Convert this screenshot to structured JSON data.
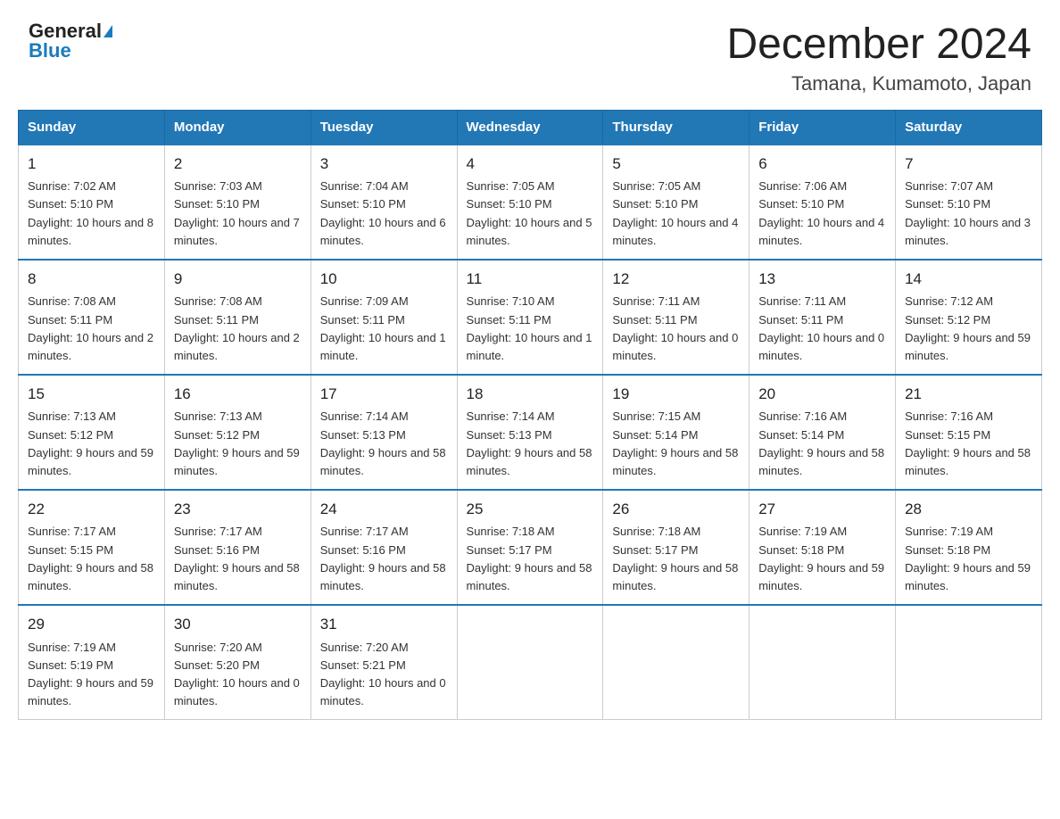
{
  "header": {
    "logo_general": "General",
    "logo_blue": "Blue",
    "title": "December 2024",
    "subtitle": "Tamana, Kumamoto, Japan"
  },
  "calendar": {
    "days_of_week": [
      "Sunday",
      "Monday",
      "Tuesday",
      "Wednesday",
      "Thursday",
      "Friday",
      "Saturday"
    ],
    "weeks": [
      [
        {
          "day": "1",
          "sunrise": "7:02 AM",
          "sunset": "5:10 PM",
          "daylight": "10 hours and 8 minutes."
        },
        {
          "day": "2",
          "sunrise": "7:03 AM",
          "sunset": "5:10 PM",
          "daylight": "10 hours and 7 minutes."
        },
        {
          "day": "3",
          "sunrise": "7:04 AM",
          "sunset": "5:10 PM",
          "daylight": "10 hours and 6 minutes."
        },
        {
          "day": "4",
          "sunrise": "7:05 AM",
          "sunset": "5:10 PM",
          "daylight": "10 hours and 5 minutes."
        },
        {
          "day": "5",
          "sunrise": "7:05 AM",
          "sunset": "5:10 PM",
          "daylight": "10 hours and 4 minutes."
        },
        {
          "day": "6",
          "sunrise": "7:06 AM",
          "sunset": "5:10 PM",
          "daylight": "10 hours and 4 minutes."
        },
        {
          "day": "7",
          "sunrise": "7:07 AM",
          "sunset": "5:10 PM",
          "daylight": "10 hours and 3 minutes."
        }
      ],
      [
        {
          "day": "8",
          "sunrise": "7:08 AM",
          "sunset": "5:11 PM",
          "daylight": "10 hours and 2 minutes."
        },
        {
          "day": "9",
          "sunrise": "7:08 AM",
          "sunset": "5:11 PM",
          "daylight": "10 hours and 2 minutes."
        },
        {
          "day": "10",
          "sunrise": "7:09 AM",
          "sunset": "5:11 PM",
          "daylight": "10 hours and 1 minute."
        },
        {
          "day": "11",
          "sunrise": "7:10 AM",
          "sunset": "5:11 PM",
          "daylight": "10 hours and 1 minute."
        },
        {
          "day": "12",
          "sunrise": "7:11 AM",
          "sunset": "5:11 PM",
          "daylight": "10 hours and 0 minutes."
        },
        {
          "day": "13",
          "sunrise": "7:11 AM",
          "sunset": "5:11 PM",
          "daylight": "10 hours and 0 minutes."
        },
        {
          "day": "14",
          "sunrise": "7:12 AM",
          "sunset": "5:12 PM",
          "daylight": "9 hours and 59 minutes."
        }
      ],
      [
        {
          "day": "15",
          "sunrise": "7:13 AM",
          "sunset": "5:12 PM",
          "daylight": "9 hours and 59 minutes."
        },
        {
          "day": "16",
          "sunrise": "7:13 AM",
          "sunset": "5:12 PM",
          "daylight": "9 hours and 59 minutes."
        },
        {
          "day": "17",
          "sunrise": "7:14 AM",
          "sunset": "5:13 PM",
          "daylight": "9 hours and 58 minutes."
        },
        {
          "day": "18",
          "sunrise": "7:14 AM",
          "sunset": "5:13 PM",
          "daylight": "9 hours and 58 minutes."
        },
        {
          "day": "19",
          "sunrise": "7:15 AM",
          "sunset": "5:14 PM",
          "daylight": "9 hours and 58 minutes."
        },
        {
          "day": "20",
          "sunrise": "7:16 AM",
          "sunset": "5:14 PM",
          "daylight": "9 hours and 58 minutes."
        },
        {
          "day": "21",
          "sunrise": "7:16 AM",
          "sunset": "5:15 PM",
          "daylight": "9 hours and 58 minutes."
        }
      ],
      [
        {
          "day": "22",
          "sunrise": "7:17 AM",
          "sunset": "5:15 PM",
          "daylight": "9 hours and 58 minutes."
        },
        {
          "day": "23",
          "sunrise": "7:17 AM",
          "sunset": "5:16 PM",
          "daylight": "9 hours and 58 minutes."
        },
        {
          "day": "24",
          "sunrise": "7:17 AM",
          "sunset": "5:16 PM",
          "daylight": "9 hours and 58 minutes."
        },
        {
          "day": "25",
          "sunrise": "7:18 AM",
          "sunset": "5:17 PM",
          "daylight": "9 hours and 58 minutes."
        },
        {
          "day": "26",
          "sunrise": "7:18 AM",
          "sunset": "5:17 PM",
          "daylight": "9 hours and 58 minutes."
        },
        {
          "day": "27",
          "sunrise": "7:19 AM",
          "sunset": "5:18 PM",
          "daylight": "9 hours and 59 minutes."
        },
        {
          "day": "28",
          "sunrise": "7:19 AM",
          "sunset": "5:18 PM",
          "daylight": "9 hours and 59 minutes."
        }
      ],
      [
        {
          "day": "29",
          "sunrise": "7:19 AM",
          "sunset": "5:19 PM",
          "daylight": "9 hours and 59 minutes."
        },
        {
          "day": "30",
          "sunrise": "7:20 AM",
          "sunset": "5:20 PM",
          "daylight": "10 hours and 0 minutes."
        },
        {
          "day": "31",
          "sunrise": "7:20 AM",
          "sunset": "5:21 PM",
          "daylight": "10 hours and 0 minutes."
        },
        null,
        null,
        null,
        null
      ]
    ]
  }
}
